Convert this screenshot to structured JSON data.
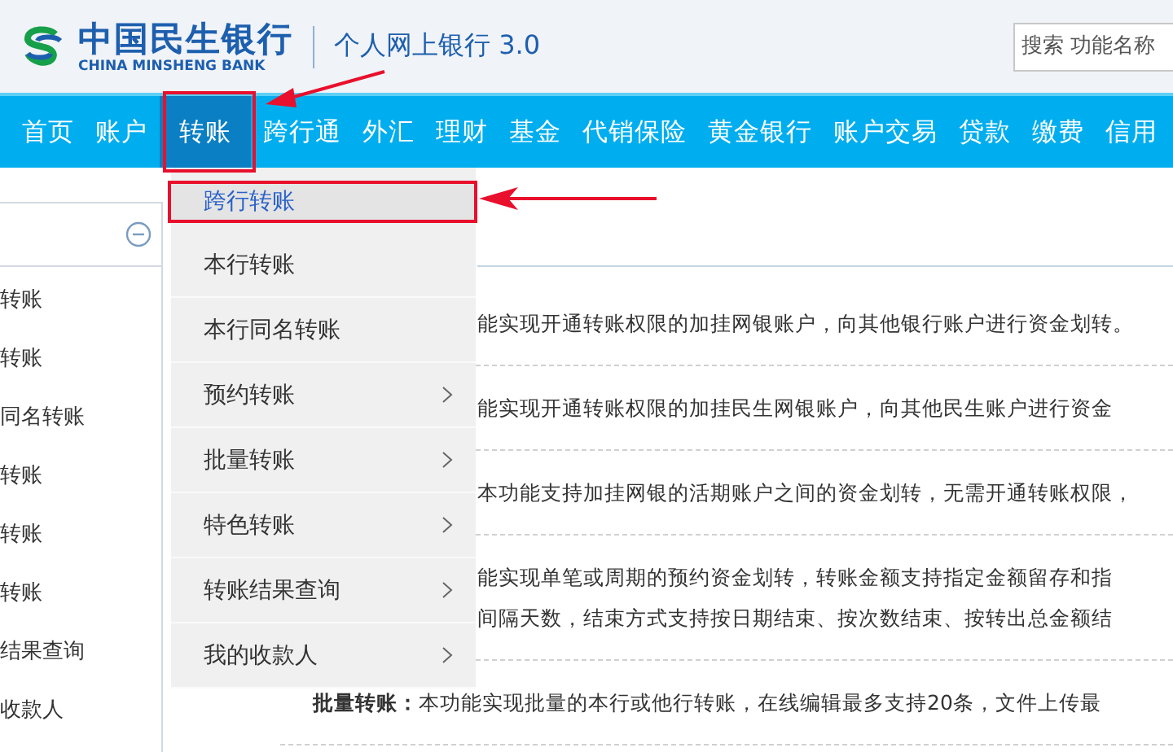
{
  "header": {
    "logo": {
      "name_cn": "中国民生银行",
      "name_en": "CHINA MINSHENG BANK"
    },
    "product": "个人网上银行 3.0",
    "search": {
      "placeholder": "搜索 功能名称"
    }
  },
  "nav": [
    {
      "label": "首页",
      "selected": false
    },
    {
      "label": "账户",
      "selected": false
    },
    {
      "label": "转账",
      "selected": true
    },
    {
      "label": "跨行通",
      "selected": false
    },
    {
      "label": "外汇",
      "selected": false
    },
    {
      "label": "理财",
      "selected": false
    },
    {
      "label": "基金",
      "selected": false
    },
    {
      "label": "代销保险",
      "selected": false
    },
    {
      "label": "黄金银行",
      "selected": false
    },
    {
      "label": "账户交易",
      "selected": false
    },
    {
      "label": "贷款",
      "selected": false
    },
    {
      "label": "缴费",
      "selected": false
    },
    {
      "label": "信用",
      "selected": false
    }
  ],
  "dropdown": [
    {
      "label": "跨行转账",
      "selected": true,
      "submenu": false
    },
    {
      "label": "本行转账",
      "selected": false,
      "submenu": false
    },
    {
      "label": "本行同名转账",
      "selected": false,
      "submenu": false
    },
    {
      "label": "预约转账",
      "selected": false,
      "submenu": true
    },
    {
      "label": "批量转账",
      "selected": false,
      "submenu": true
    },
    {
      "label": "特色转账",
      "selected": false,
      "submenu": true
    },
    {
      "label": "转账结果查询",
      "selected": false,
      "submenu": true
    },
    {
      "label": "我的收款人",
      "selected": false,
      "submenu": true
    }
  ],
  "sidebar": {
    "items": [
      "转账",
      "转账",
      "同名转账",
      "转账",
      "转账",
      "转账",
      "结果查询",
      "收款人"
    ]
  },
  "content": {
    "rows": [
      {
        "kind": "covered",
        "lines": [
          "能实现开通转账权限的加挂网银账户，向其他银行账户进行资金划转。"
        ]
      },
      {
        "kind": "covered",
        "lines": [
          "能实现开通转账权限的加挂民生网银账户，向其他民生账户进行资金"
        ]
      },
      {
        "kind": "covered",
        "lines": [
          "本功能支持加挂网银的活期账户之间的资金划转，无需开通转账权限，"
        ]
      },
      {
        "kind": "covered",
        "lines": [
          "能实现单笔或周期的预约资金划转，转账金额支持指定金额留存和指",
          "间隔天数，结束方式支持按日期结束、按次数结束、按转出总金额结"
        ]
      },
      {
        "kind": "full",
        "title": "批量转账：",
        "lines": [
          "本功能实现批量的本行或他行转账，在线编辑最多支持20条，文件上传最"
        ]
      }
    ]
  }
}
